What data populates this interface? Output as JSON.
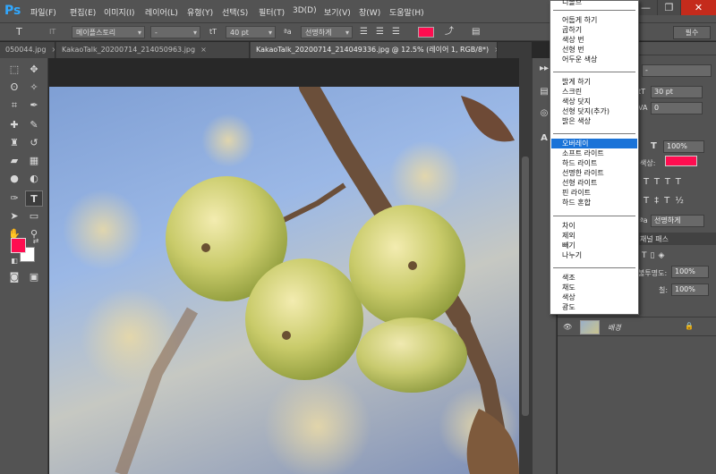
{
  "app": {
    "logo": "Ps"
  },
  "menu": [
    "파일(F)",
    "편집(E)",
    "이미지(I)",
    "레이어(L)",
    "유형(Y)",
    "선택(S)",
    "필터(T)",
    "3D(D)",
    "보기(V)",
    "창(W)",
    "도움말(H)"
  ],
  "window_controls": {
    "minimize": "—",
    "restore": "❐",
    "close": "✕"
  },
  "options": {
    "tool_glyph": "T",
    "orient_glyph": "IT",
    "font_family": "메이플스토리",
    "font_style": "-",
    "size_glyph": "tT",
    "font_size": "40 pt",
    "aa_glyph": "ªa",
    "antialias": "선명하게",
    "text_color": "#ff0d50",
    "essentials": "필수"
  },
  "tabs": [
    {
      "label": "050044.jpg",
      "close": "×"
    },
    {
      "label": "KakaoTalk_20200714_214050963.jpg",
      "close": "×"
    },
    {
      "label": "KakaoTalk_20200714_214049336.jpg @ 12.5% (레이어 1, RGB/8*)",
      "close": "×"
    }
  ],
  "colors": {
    "foreground": "#ff0d50",
    "background": "#ffffff",
    "accent": "#1a73d8"
  },
  "toolbar_icons": [
    "marquee-icon",
    "move-icon",
    "lasso-icon",
    "magic-wand-icon",
    "crop-icon",
    "eyedropper-icon",
    "healing-icon",
    "brush-icon",
    "stamp-icon",
    "history-brush-icon",
    "eraser-icon",
    "gradient-icon",
    "blur-icon",
    "dodge-icon",
    "pen-icon",
    "type-icon",
    "path-select-icon",
    "shape-icon",
    "hand-icon",
    "zoom-icon"
  ],
  "character_panel": {
    "size": "30 pt",
    "tracking": "0",
    "scale": "100%",
    "color_label": "색상:",
    "color": "#ff0d50",
    "antialias": "선명하게",
    "aa_label": "ªa"
  },
  "layers_panel": {
    "tabs": "채널 패스",
    "opacity_label": "불투명도:",
    "opacity": "100%",
    "fill_label": "칠:",
    "fill": "100%",
    "layer_name": "배경"
  },
  "blend_modes": {
    "top_cut": "디졸브",
    "groups": [
      [
        "어둡게 하기",
        "곱하기",
        "색상 번",
        "선형 번",
        "어두운 색상"
      ],
      [
        "밝게 하기",
        "스크린",
        "색상 닷지",
        "선형 닷지(추가)",
        "밝은 색상"
      ],
      [
        "오버레이",
        "소프트 라이트",
        "하드 라이트",
        "선명한 라이트",
        "선형 라이트",
        "핀 라이트",
        "하드 혼합"
      ],
      [
        "차이",
        "제외",
        "빼기",
        "나누기"
      ],
      [
        "색조",
        "채도",
        "색상",
        "광도"
      ]
    ],
    "selected": "오버레이"
  }
}
